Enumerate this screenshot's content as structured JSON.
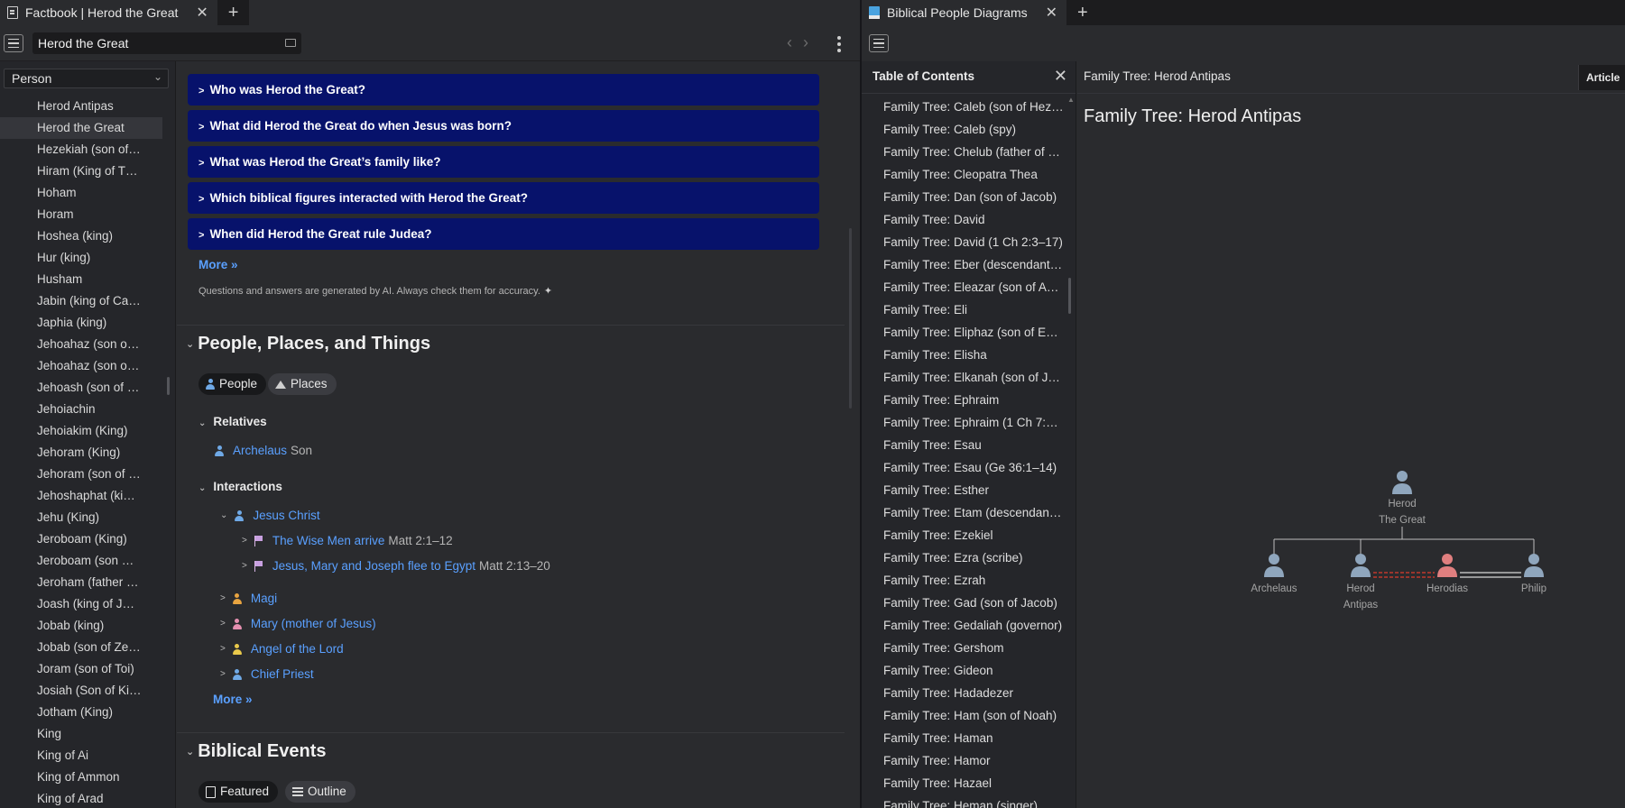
{
  "left_tab": {
    "title": "Factbook | Herod the Great",
    "close": "✕",
    "add": "+"
  },
  "search": {
    "value": "Herod the Great"
  },
  "type_select": {
    "value": "Person",
    "chev": "⌄"
  },
  "nav": {
    "back": "‹",
    "forward": "›"
  },
  "people_list": [
    "Herod Antipas",
    "Herod the Great",
    "Hezekiah (son of…",
    "Hiram (King of T…",
    "Hoham",
    "Horam",
    "Hoshea (king)",
    "Hur (king)",
    "Husham",
    "Jabin (king of Ca…",
    "Japhia (king)",
    "Jehoahaz (son o…",
    "Jehoahaz (son o…",
    "Jehoash (son of …",
    "Jehoiachin",
    "Jehoiakim (King)",
    "Jehoram (King)",
    "Jehoram (son of …",
    "Jehoshaphat (ki…",
    "Jehu (King)",
    "Jeroboam (King)",
    "Jeroboam (son …",
    "Jeroham (father …",
    "Joash (king of J…",
    "Jobab (king)",
    "Jobab (son of Ze…",
    "Joram (son of Toi)",
    "Josiah (Son of Ki…",
    "Jotham (King)",
    "King",
    "King of Ai",
    "King of Ammon",
    "King of Arad"
  ],
  "active_person_index": 1,
  "questions": [
    "Who was Herod the Great?",
    "What did Herod the Great do when Jesus was born?",
    "What was Herod the Great’s family like?",
    "Which biblical figures interacted with Herod the Great?",
    "When did Herod the Great rule Judea?"
  ],
  "more_label": "More »",
  "disclaimer": "Questions and answers are generated by AI. Always check them for accuracy.",
  "sparkle": "✦",
  "section_people": {
    "title": "People, Places, and Things",
    "tab_people": "People",
    "tab_places": "Places",
    "relatives_title": "Relatives",
    "relative_name": "Archelaus",
    "relative_role": "Son",
    "interactions_title": "Interactions",
    "jesus": "Jesus Christ",
    "event1_name": "The Wise Men arrive",
    "event1_ref": "Matt 2:1–12",
    "event2_name": "Jesus, Mary and Joseph flee to Egypt",
    "event2_ref": "Matt 2:13–20",
    "magi": "Magi",
    "mary": "Mary (mother of Jesus)",
    "angel": "Angel of the Lord",
    "priest": "Chief Priest",
    "more": "More »"
  },
  "section_events": {
    "title": "Biblical Events",
    "tab_featured": "Featured",
    "tab_outline": "Outline"
  },
  "right_tab": {
    "title": "Biblical People Diagrams",
    "close": "✕",
    "add": "+"
  },
  "toc": {
    "title": "Table of Contents",
    "close": "✕",
    "items": [
      "Family Tree: Caleb (son of Hezron)",
      "Family Tree: Caleb (spy)",
      "Family Tree: Chelub (father of M…",
      "Family Tree: Cleopatra Thea",
      "Family Tree: Dan (son of Jacob)",
      "Family Tree: David",
      "Family Tree: David (1 Ch 2:3–17)",
      "Family Tree: Eber (descendant…",
      "Family Tree: Eleazar (son of Aar…",
      "Family Tree: Eli",
      "Family Tree: Eliphaz (son of Esau)",
      "Family Tree: Elisha",
      "Family Tree: Elkanah (son of Joel)",
      "Family Tree: Ephraim",
      "Family Tree: Ephraim (1 Ch 7:20…",
      "Family Tree: Esau",
      "Family Tree: Esau (Ge 36:1–14)",
      "Family Tree: Esther",
      "Family Tree: Etam (descendant…",
      "Family Tree: Ezekiel",
      "Family Tree: Ezra (scribe)",
      "Family Tree: Ezrah",
      "Family Tree: Gad (son of Jacob)",
      "Family Tree: Gedaliah (governor)",
      "Family Tree: Gershom",
      "Family Tree: Gideon",
      "Family Tree: Hadadezer",
      "Family Tree: Ham (son of Noah)",
      "Family Tree: Haman",
      "Family Tree: Hamor",
      "Family Tree: Hazael",
      "Family Tree: Heman (singer)"
    ]
  },
  "article": {
    "header": "Family Tree: Herod Antipas",
    "tab": "Article",
    "title": "Family Tree: Herod Antipas"
  },
  "family_tree": {
    "root": {
      "line1": "Herod",
      "line2": "The Great",
      "color": "#8fa6bd"
    },
    "children": [
      {
        "line1": "Archelaus",
        "line2": "",
        "color": "#8fa6bd"
      },
      {
        "line1": "Herod",
        "line2": "Antipas",
        "color": "#8fa6bd"
      },
      {
        "line1": "Herodias",
        "line2": "",
        "color": "#e07f7f"
      },
      {
        "line1": "Philip",
        "line2": "",
        "color": "#8fa6bd"
      }
    ]
  },
  "colors": {
    "qa_bg": "#07126b",
    "link": "#5aa0ff",
    "person_blue": "#6fa9e6",
    "person_orange": "#e8a440",
    "person_pink": "#e58fb0",
    "person_yellow": "#e9c94b",
    "marriage_red": "#c0392b"
  }
}
